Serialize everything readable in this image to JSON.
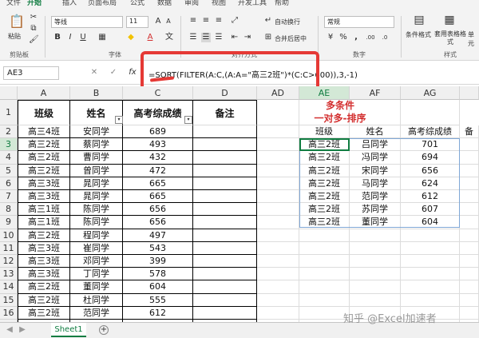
{
  "ribbon": {
    "tabs": [
      "文件",
      "开始",
      "插入",
      "页面布局",
      "公式",
      "数据",
      "审阅",
      "视图",
      "开发工具",
      "帮助"
    ],
    "font_name": "等线",
    "font_size": "11",
    "number_format": "常规",
    "paste_label": "粘贴",
    "clipboard_label": "剪贴板",
    "font_group_label": "字体",
    "align_group_label": "对齐方式",
    "wrap_label": "自动换行",
    "merge_label": "合并后居中",
    "number_group_label": "数字",
    "cond_format_label": "条件格式",
    "table_format_label": "套用表格格式",
    "cell_style_label": "单元",
    "style_group_label": "样式"
  },
  "formula_bar": {
    "name_box": "AE3",
    "fx": "fx",
    "formula": "=SORT(FILTER(A:C,(A:A=\"高三2班\")*(C:C>600)),3,-1)"
  },
  "columns": [
    "A",
    "B",
    "C",
    "D",
    "AD",
    "AE",
    "AF",
    "AG"
  ],
  "rows": [
    "1",
    "2",
    "3",
    "4",
    "5",
    "6",
    "7",
    "8",
    "9",
    "10",
    "11",
    "12",
    "13",
    "14",
    "15",
    "16",
    "17"
  ],
  "table": {
    "headers": [
      "班级",
      "姓名",
      "高考综成绩",
      "备注"
    ],
    "data": [
      [
        "高三4班",
        "安同学",
        "689"
      ],
      [
        "高三2班",
        "蔡同学",
        "493"
      ],
      [
        "高三2班",
        "曹同学",
        "432"
      ],
      [
        "高三2班",
        "曾同学",
        "472"
      ],
      [
        "高三3班",
        "晁同学",
        "665"
      ],
      [
        "高三3班",
        "晁同学",
        "665"
      ],
      [
        "高三1班",
        "陈同学",
        "656"
      ],
      [
        "高三1班",
        "陈同学",
        "656"
      ],
      [
        "高三2班",
        "程同学",
        "497"
      ],
      [
        "高三3班",
        "崔同学",
        "543"
      ],
      [
        "高三3班",
        "邓同学",
        "399"
      ],
      [
        "高三3班",
        "丁同学",
        "578"
      ],
      [
        "高三2班",
        "董同学",
        "604"
      ],
      [
        "高三2班",
        "杜同学",
        "555"
      ],
      [
        "高三2班",
        "范同学",
        "612"
      ]
    ]
  },
  "result": {
    "title_line1": "多条件",
    "title_line2": "一对多-排序",
    "headers": [
      "班级",
      "姓名",
      "高考综成绩",
      "备"
    ],
    "data": [
      [
        "高三2班",
        "吕同学",
        "701"
      ],
      [
        "高三2班",
        "冯同学",
        "694"
      ],
      [
        "高三2班",
        "宋同学",
        "656"
      ],
      [
        "高三2班",
        "马同学",
        "624"
      ],
      [
        "高三2班",
        "范同学",
        "612"
      ],
      [
        "高三2班",
        "苏同学",
        "607"
      ],
      [
        "高三2班",
        "董同学",
        "604"
      ]
    ]
  },
  "sheet_tab": "Sheet1",
  "add_sheet": "+",
  "watermark": "知乎 @Excel加速者"
}
